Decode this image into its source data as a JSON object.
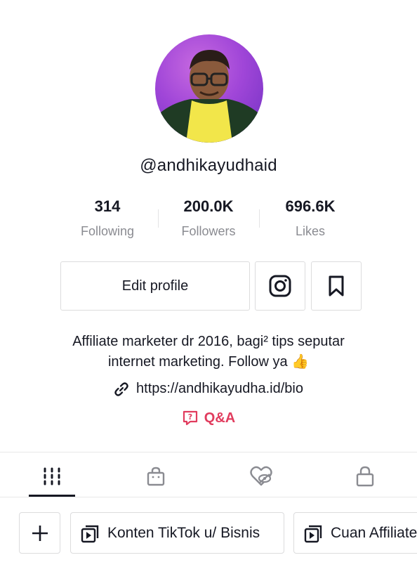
{
  "profile": {
    "username": "@andhikayudhaid"
  },
  "stats": [
    {
      "value": "314",
      "label": "Following"
    },
    {
      "value": "200.0K",
      "label": "Followers"
    },
    {
      "value": "696.6K",
      "label": "Likes"
    }
  ],
  "actions": {
    "edit_profile": "Edit profile",
    "instagram_icon": "instagram-icon",
    "bookmark_icon": "bookmark-icon"
  },
  "bio": {
    "line1": "Affiliate marketer dr 2016, bagi² tips seputar",
    "line2": "internet marketing. Follow ya 👍",
    "link": "https://andhikayudha.id/bio",
    "qa": "Q&A"
  },
  "tabs": [
    {
      "icon": "grid-icon",
      "active": true
    },
    {
      "icon": "shopping-bag-icon",
      "active": false
    },
    {
      "icon": "liked-hidden-icon",
      "active": false
    },
    {
      "icon": "lock-icon",
      "active": false
    }
  ],
  "playlists": {
    "add_icon": "plus-icon",
    "items": [
      {
        "label": "Konten TikTok u/ Bisnis"
      },
      {
        "label": "Cuan Affiliate"
      }
    ]
  },
  "colors": {
    "accent": "#e13c5e",
    "text": "#161823",
    "muted": "#8a8b91",
    "avatar_bg": "#a046d8"
  }
}
